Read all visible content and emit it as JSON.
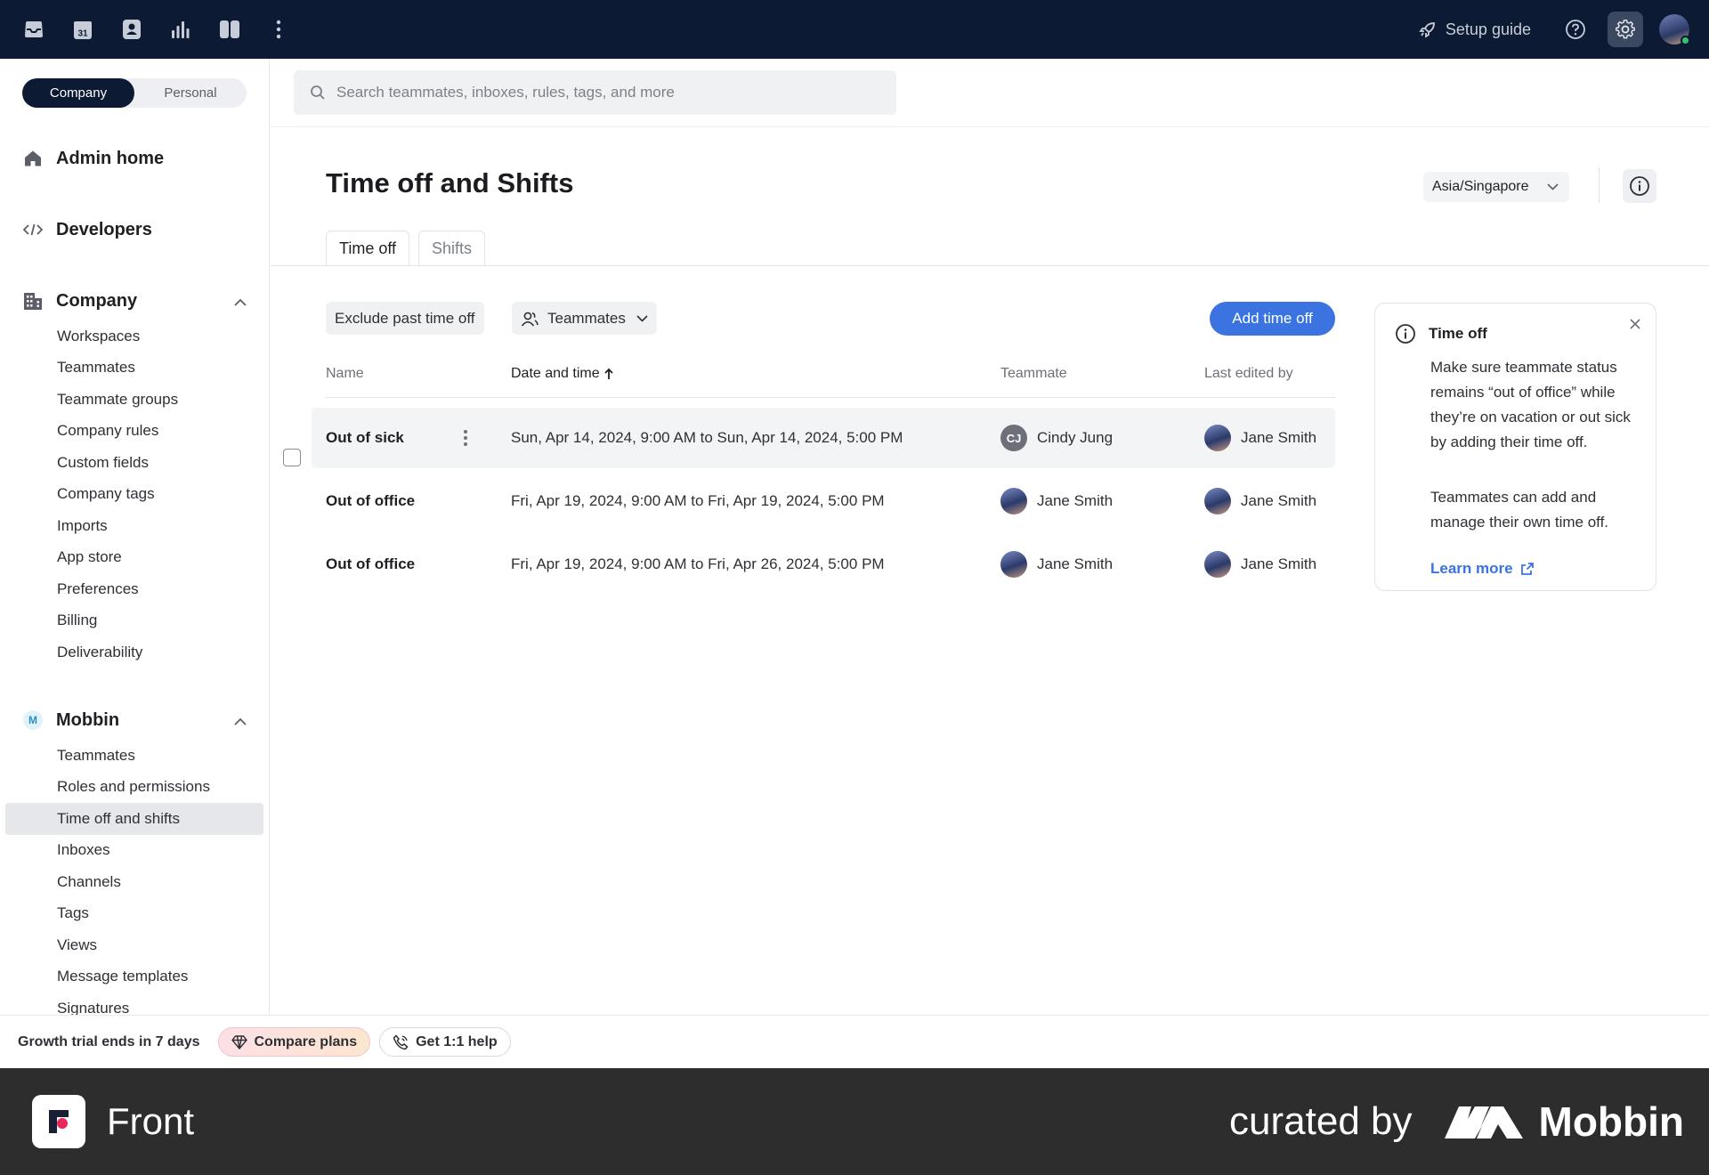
{
  "topbar": {
    "icons": [
      "inbox-icon",
      "calendar-icon",
      "contacts-icon",
      "analytics-icon",
      "split-view-icon",
      "more-icon"
    ],
    "calendar_day": "31",
    "setup_guide": "Setup guide"
  },
  "sidebar": {
    "scope_company": "Company",
    "scope_personal": "Personal",
    "admin_home": "Admin home",
    "developers": "Developers",
    "company_section": {
      "title": "Company",
      "items": [
        "Workspaces",
        "Teammates",
        "Teammate groups",
        "Company rules",
        "Custom fields",
        "Company tags",
        "Imports",
        "App store",
        "Preferences",
        "Billing",
        "Deliverability"
      ]
    },
    "workspace_section": {
      "badge": "M",
      "title": "Mobbin",
      "items": [
        "Teammates",
        "Roles and permissions",
        "Time off and shifts",
        "Inboxes",
        "Channels",
        "Tags",
        "Views",
        "Message templates",
        "Signatures"
      ],
      "active_index": 2
    }
  },
  "search": {
    "placeholder": "Search teammates, inboxes, rules, tags, and more"
  },
  "page": {
    "title": "Time off and Shifts",
    "timezone": "Asia/Singapore",
    "tabs": [
      "Time off",
      "Shifts"
    ],
    "active_tab": 0
  },
  "toolbar": {
    "exclude_past": "Exclude past time off",
    "teammates_filter": "Teammates",
    "add_button": "Add time off"
  },
  "table": {
    "headers": {
      "name": "Name",
      "date": "Date and time",
      "teammate": "Teammate",
      "edited": "Last edited by"
    },
    "rows": [
      {
        "name": "Out of sick",
        "date": "Sun, Apr 14, 2024, 9:00 AM to Sun, Apr 14, 2024, 5:00 PM",
        "teammate": "Cindy Jung",
        "teammate_initials": "CJ",
        "edited_by": "Jane Smith"
      },
      {
        "name": "Out of office",
        "date": "Fri, Apr 19, 2024, 9:00 AM to Fri, Apr 19, 2024, 5:00 PM",
        "teammate": "Jane Smith",
        "teammate_initials": "",
        "edited_by": "Jane Smith"
      },
      {
        "name": "Out of office",
        "date": "Fri, Apr 19, 2024, 9:00 AM to Fri, Apr 26, 2024, 5:00 PM",
        "teammate": "Jane Smith",
        "teammate_initials": "",
        "edited_by": "Jane Smith"
      }
    ]
  },
  "info_card": {
    "title": "Time off",
    "para1": "Make sure teammate status remains “out of office” while they’re on vacation or out sick by adding their time off.",
    "para2": "Teammates can add and manage their own time off.",
    "learn_more": "Learn more"
  },
  "trial": {
    "text": "Growth trial ends in 7 days",
    "compare": "Compare plans",
    "help": "Get 1:1 help"
  },
  "footer": {
    "app_name": "Front",
    "curated_by": "curated by",
    "brand": "Mobbin"
  },
  "colors": {
    "topbar": "#0c1a33",
    "accent": "#3b73e0",
    "footer": "#2d2d2d"
  }
}
